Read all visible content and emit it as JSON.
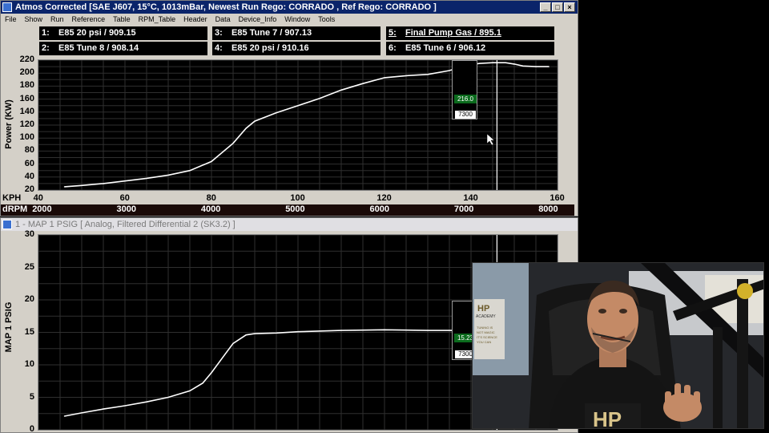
{
  "top_window": {
    "title": "Atmos Corrected [SAE J607, 15°C, 1013mBar,  Newest Run Rego: CORRADO ,  Ref Rego: CORRADO ]",
    "menu": [
      "File",
      "Show",
      "Run",
      "Reference",
      "Table",
      "RPM_Table",
      "Header",
      "Data",
      "Device_Info",
      "Window",
      "Tools"
    ],
    "runs": [
      {
        "num": "1:",
        "label": "E85 20 psi / 909.15"
      },
      {
        "num": "2:",
        "label": "E85 Tune 8 / 908.14"
      },
      {
        "num": "3:",
        "label": "E85 Tune 7 / 907.13"
      },
      {
        "num": "4:",
        "label": "E85 20 psi / 910.16"
      },
      {
        "num": "5:",
        "label": "Final Pump Gas / 895.1"
      },
      {
        "num": "6:",
        "label": "E85 Tune 6 / 906.12"
      }
    ],
    "y_label": "Power (KW)",
    "y_ticks": [
      "220",
      "200",
      "180",
      "160",
      "140",
      "120",
      "100",
      "80",
      "60",
      "40",
      "20"
    ],
    "x_name": "KPH",
    "x_ticks": [
      "40",
      "60",
      "80",
      "100",
      "120",
      "140",
      "160"
    ],
    "rpm_name": "dRPM",
    "rpm_ticks": [
      "2000",
      "3000",
      "4000",
      "5000",
      "6000",
      "7000",
      "8000"
    ],
    "cursor_value": "216.0",
    "cursor_rpm": "7300"
  },
  "bottom_window": {
    "title": "1 - MAP 1 PSIG    [ Analog, Filtered Differential 2 (SK3.2) ]",
    "y_label": "MAP 1 PSIG",
    "y_ticks": [
      "30",
      "25",
      "20",
      "15",
      "10",
      "5",
      "0"
    ],
    "cursor_value": "15.23",
    "cursor_rpm": "7300"
  },
  "colors": {
    "title_active": "#0a246a",
    "window_bg": "#d4d0c8",
    "plot_bg": "#000000",
    "grid": "#2f2f2f",
    "trace": "#ffffff",
    "cursor_green": "#0b6b1d"
  },
  "webcam": {
    "badge_brand": "HP ACADEMY",
    "badge_text": "TUNING IS NOT MAGIC IT'S SCIENCE YOU CAN",
    "shirt_text": "HP"
  },
  "chart_data": [
    {
      "type": "line",
      "title": "",
      "xlabel": "KPH",
      "ylabel": "Power (KW)",
      "xlim": [
        40,
        160
      ],
      "ylim": [
        20,
        220
      ],
      "series": [
        {
          "name": "Final Pump Gas / 895.1",
          "x": [
            46,
            50,
            55,
            60,
            65,
            70,
            75,
            80,
            85,
            88,
            90,
            95,
            100,
            105,
            110,
            115,
            120,
            125,
            130,
            135,
            139,
            142,
            145,
            148,
            150,
            152,
            155,
            158
          ],
          "y": [
            25,
            27,
            30,
            34,
            38,
            43,
            50,
            64,
            92,
            115,
            126,
            139,
            150,
            161,
            174,
            184,
            193,
            196,
            198,
            204,
            212,
            215,
            216,
            216,
            214,
            211,
            210,
            210
          ]
        }
      ]
    },
    {
      "type": "line",
      "title": "",
      "xlabel": "KPH",
      "ylabel": "MAP 1 PSIG",
      "xlim": [
        40,
        160
      ],
      "ylim": [
        0,
        30
      ],
      "series": [
        {
          "name": "Final Pump Gas / 895.1",
          "x": [
            46,
            50,
            55,
            60,
            65,
            70,
            75,
            78,
            80,
            83,
            85,
            88,
            90,
            95,
            100,
            110,
            120,
            130,
            140,
            145
          ],
          "y": [
            2.1,
            2.6,
            3.2,
            3.7,
            4.3,
            5.0,
            6.0,
            7.2,
            8.8,
            11.5,
            13.3,
            14.6,
            14.8,
            14.9,
            15.1,
            15.3,
            15.4,
            15.3,
            15.3,
            15.2
          ]
        }
      ]
    }
  ]
}
